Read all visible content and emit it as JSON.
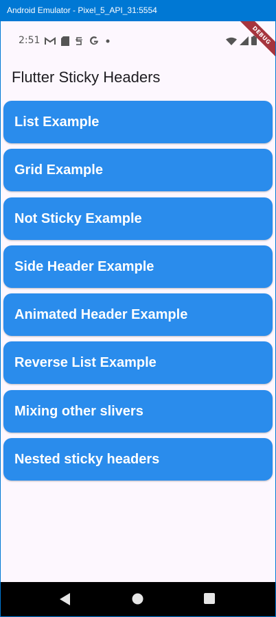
{
  "window": {
    "title": "Android Emulator - Pixel_5_API_31:5554"
  },
  "status_bar": {
    "time": "2:51",
    "left_icons": [
      "gmail-icon",
      "sd-card-icon",
      "sync-icon",
      "google-icon",
      "dot-icon"
    ],
    "right_icons": [
      "wifi-icon",
      "signal-icon",
      "battery-icon"
    ],
    "debug_banner": "DEBUG"
  },
  "app_bar": {
    "title": "Flutter Sticky Headers"
  },
  "examples": [
    {
      "label": "List Example"
    },
    {
      "label": "Grid Example"
    },
    {
      "label": "Not Sticky Example"
    },
    {
      "label": "Side Header Example"
    },
    {
      "label": "Animated Header Example"
    },
    {
      "label": "Reverse List Example"
    },
    {
      "label": "Mixing other slivers"
    },
    {
      "label": "Nested sticky headers"
    }
  ],
  "nav_bar": {
    "buttons": [
      "back-icon",
      "home-icon",
      "recents-icon"
    ]
  },
  "colors": {
    "window_accent": "#0078d4",
    "button_fill": "#2a8cec",
    "background": "#fdf7fe",
    "debug_banner": "#a6353e"
  }
}
